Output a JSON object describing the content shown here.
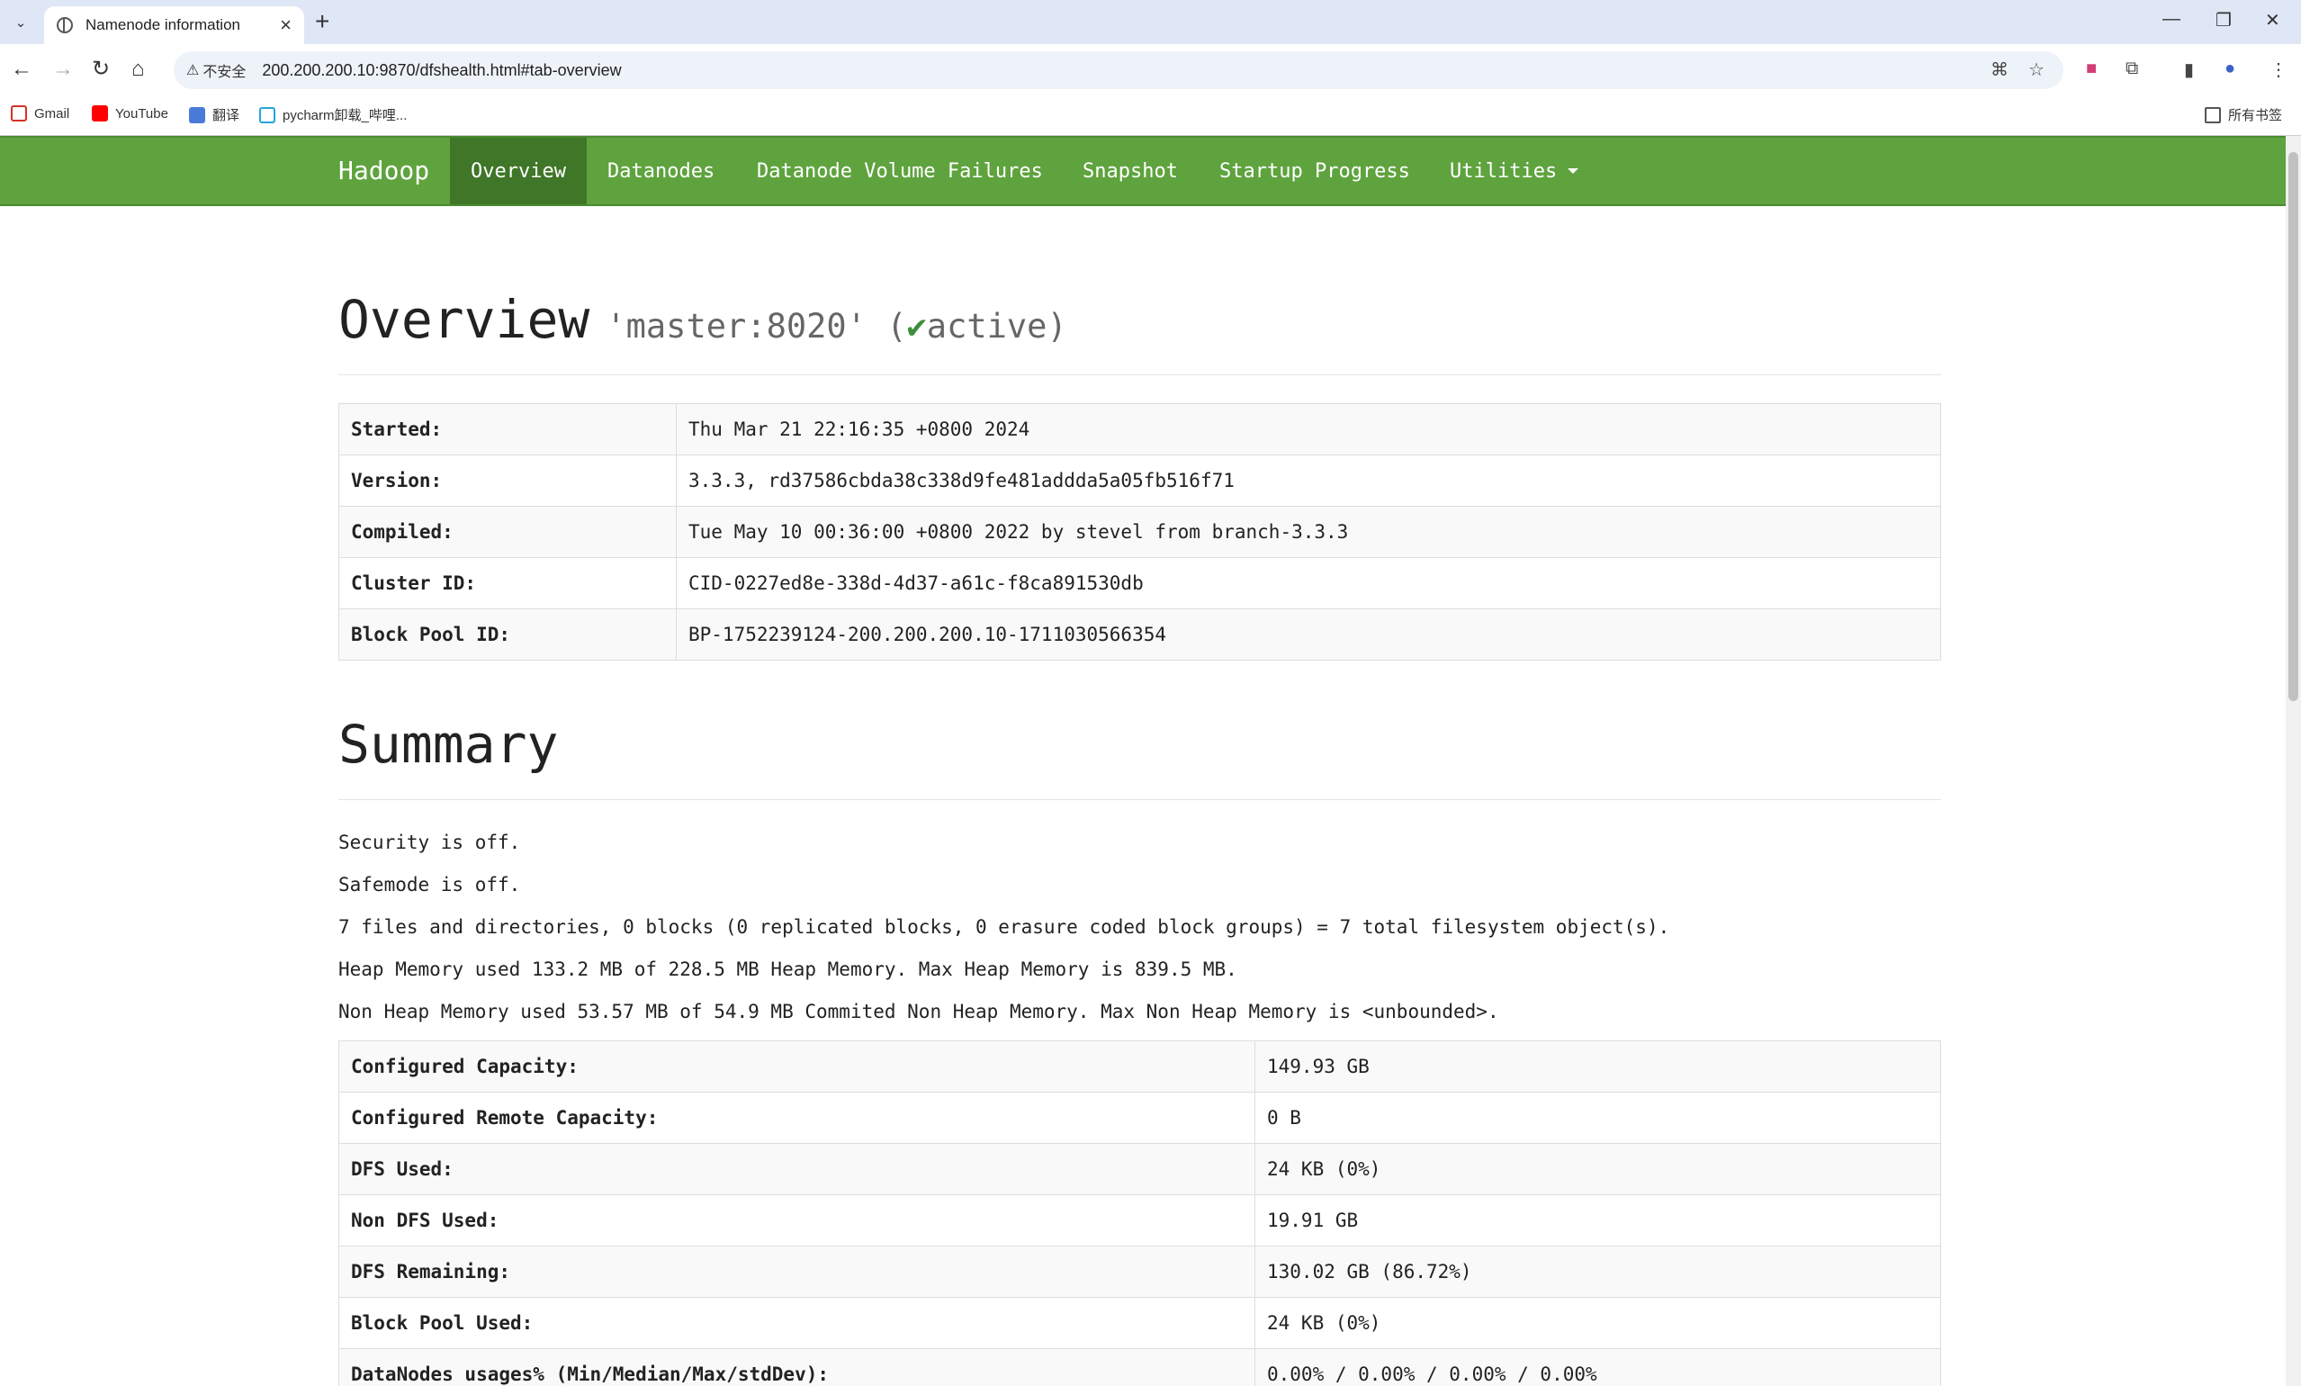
{
  "browser": {
    "tab_title": "Namenode information",
    "omnibox_security": "不安全",
    "url": "200.200.200.10:9870/dfshealth.html#tab-overview",
    "bookmarks": [
      "Gmail",
      "YouTube",
      "翻译",
      "pycharm卸载_哔哩..."
    ],
    "all_bookmarks": "所有书签"
  },
  "navbar": {
    "brand": "Hadoop",
    "items": [
      "Overview",
      "Datanodes",
      "Datanode Volume Failures",
      "Snapshot",
      "Startup Progress",
      "Utilities"
    ]
  },
  "overview": {
    "title": "Overview",
    "host": "'master:8020'",
    "state_open": "(",
    "check": "✔",
    "state": "active)",
    "rows": [
      {
        "label": "Started:",
        "value": "Thu Mar 21 22:16:35 +0800 2024"
      },
      {
        "label": "Version:",
        "value": "3.3.3, rd37586cbda38c338d9fe481addda5a05fb516f71"
      },
      {
        "label": "Compiled:",
        "value": "Tue May 10 00:36:00 +0800 2022 by stevel from branch-3.3.3"
      },
      {
        "label": "Cluster ID:",
        "value": "CID-0227ed8e-338d-4d37-a61c-f8ca891530db"
      },
      {
        "label": "Block Pool ID:",
        "value": "BP-1752239124-200.200.200.10-1711030566354"
      }
    ]
  },
  "summary": {
    "title": "Summary",
    "lines": [
      "Security is off.",
      "Safemode is off.",
      "7 files and directories, 0 blocks (0 replicated blocks, 0 erasure coded block groups) = 7 total filesystem object(s).",
      "Heap Memory used 133.2 MB of 228.5 MB Heap Memory. Max Heap Memory is 839.5 MB.",
      "Non Heap Memory used 53.57 MB of 54.9 MB Commited Non Heap Memory. Max Non Heap Memory is <unbounded>."
    ],
    "rows": [
      {
        "label": "Configured Capacity:",
        "value": "149.93 GB"
      },
      {
        "label": "Configured Remote Capacity:",
        "value": "0 B"
      },
      {
        "label": "DFS Used:",
        "value": "24 KB (0%)"
      },
      {
        "label": "Non DFS Used:",
        "value": "19.91 GB"
      },
      {
        "label": "DFS Remaining:",
        "value": "130.02 GB (86.72%)"
      },
      {
        "label": "Block Pool Used:",
        "value": "24 KB (0%)"
      },
      {
        "label": "DataNodes usages% (Min/Median/Max/stdDev):",
        "value": "0.00% / 0.00% / 0.00% / 0.00%"
      }
    ]
  }
}
